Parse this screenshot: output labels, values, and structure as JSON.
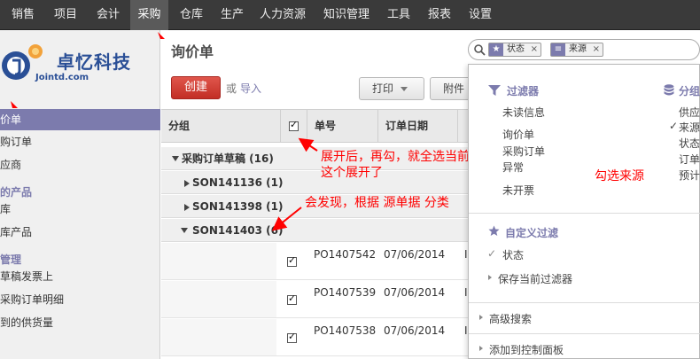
{
  "topnav": {
    "items": [
      "销售",
      "项目",
      "会计",
      "采购",
      "仓库",
      "生产",
      "人力资源",
      "知识管理",
      "工具",
      "报表",
      "设置"
    ],
    "active": "采购"
  },
  "brand": {
    "name": "卓忆科技",
    "site": "Jointd.com"
  },
  "sidebar": {
    "items": [
      "价单",
      "购订单",
      "应商"
    ],
    "section1": "的产品",
    "items2": [
      "库",
      "库产品"
    ],
    "section2": "管理",
    "items3": [
      "草稿发票上",
      "采购订单明细",
      "到的供货量"
    ]
  },
  "main": {
    "title": "询价单",
    "create_label": "创建",
    "or_label": "或",
    "import_label": "导入",
    "print_label": "打印",
    "attach_label": "附件"
  },
  "search": {
    "facets": [
      "状态",
      "来源"
    ]
  },
  "table": {
    "headers": [
      "分组",
      "单号",
      "订单日期"
    ],
    "groups": [
      {
        "label": "采购订单草稿 (16)"
      },
      {
        "label": "SON141136 (1)"
      },
      {
        "label": "SON141398 (1)"
      },
      {
        "label": "SON141403 (6)"
      }
    ],
    "rows": [
      {
        "order": "PO1407542",
        "date": "07/06/2014",
        "extra": "I"
      },
      {
        "order": "PO1407539",
        "date": "07/06/2014",
        "extra": "I"
      },
      {
        "order": "PO1407538",
        "date": "07/06/2014",
        "extra": "I"
      }
    ]
  },
  "annotations": {
    "note1_line1": "展开后，再勾，就全选当前",
    "note1_line2": "这个展开了",
    "note2": "会发现，根据 源单据 分类",
    "note3": "勾选来源"
  },
  "dropdown": {
    "filters_title": "过滤器",
    "filters": [
      "未读信息",
      "询价单",
      "采购订单",
      "异常",
      "未开票"
    ],
    "group_title": "分组",
    "group_items": [
      "供应",
      "来源",
      "状态",
      "订单",
      "预计"
    ],
    "group_checked": "来源",
    "custom_title": "自定义过滤",
    "custom_items": [
      "状态",
      "保存当前过滤器"
    ],
    "advanced": "高级搜索",
    "dashboard": "添加到控制面板"
  },
  "colors": {
    "accent": "#7c7bad",
    "create": "#d33b32",
    "annotation": "#ff0000",
    "nav": "#3a3a3a"
  }
}
